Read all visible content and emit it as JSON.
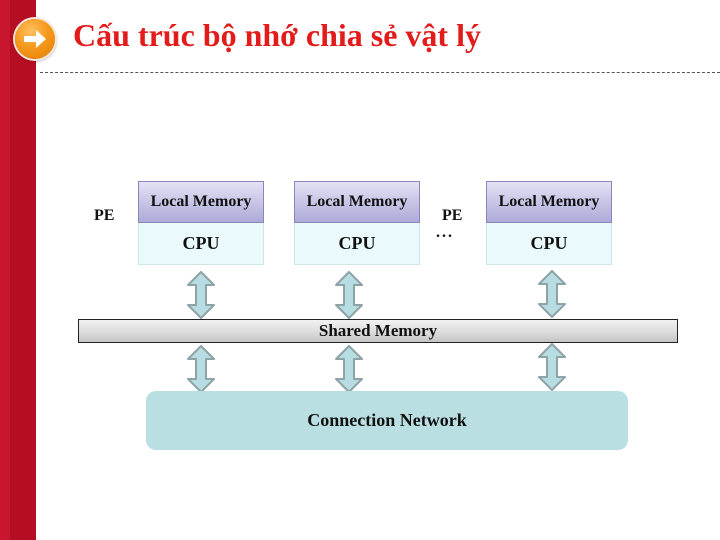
{
  "slide": {
    "title": "Cấu trúc bộ nhớ chia sẻ vật lý",
    "title_icon": "arrow-right-circle-icon",
    "accent_color": "#e21b1b",
    "sidebar_color": "#b50d22"
  },
  "diagram": {
    "pe_labels": [
      "PE",
      "PE"
    ],
    "ellipsis": "...",
    "processing_elements": [
      {
        "memory_label": "Local Memory",
        "cpu_label": "CPU"
      },
      {
        "memory_label": "Local Memory",
        "cpu_label": "CPU"
      },
      {
        "memory_label": "Local Memory",
        "cpu_label": "CPU"
      }
    ],
    "shared_memory_label": "Shared Memory",
    "connection_network_label": "Connection Network",
    "arrow_icon": "double-headed-vertical-arrow-icon"
  }
}
